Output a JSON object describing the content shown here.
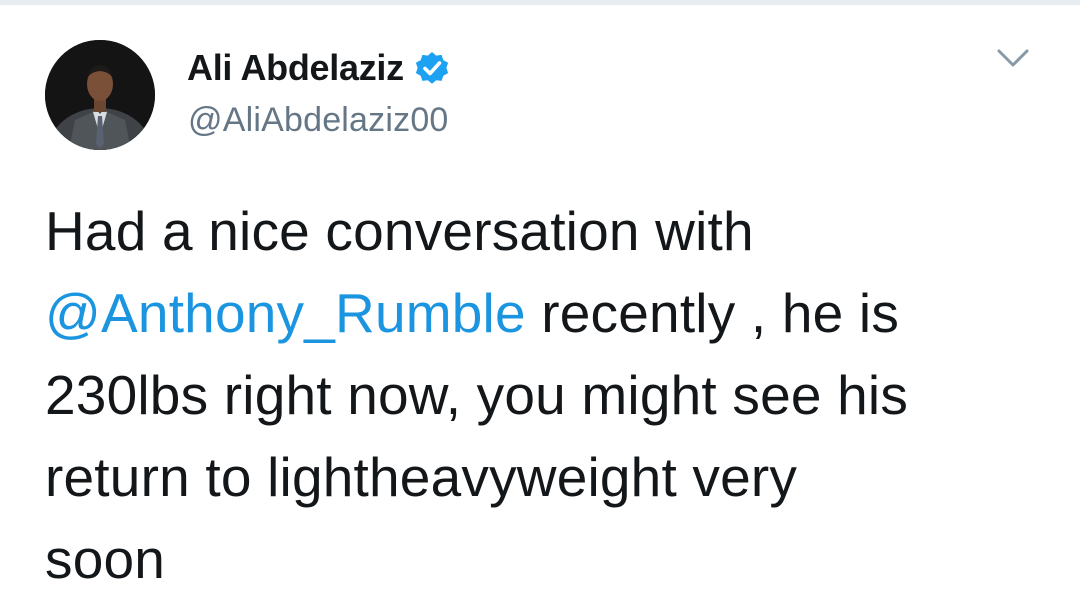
{
  "tweet": {
    "author": {
      "display_name": "Ali Abdelaziz",
      "handle": "@AliAbdelaziz00",
      "verified": true,
      "avatar_icon": "profile-photo-man-in-suit"
    },
    "text_lines": [
      {
        "pre": "Had a nice conversation with"
      },
      {
        "mention": "@Anthony_Rumble",
        "post": " recently , he is"
      },
      {
        "pre": "230lbs right now, you might see his"
      },
      {
        "pre": "return to lightheavyweight very"
      },
      {
        "pre": "soon"
      }
    ]
  },
  "icons": {
    "verified": "verified-badge-icon",
    "menu": "chevron-down-icon"
  },
  "colors": {
    "text": "#14171a",
    "secondary": "#657786",
    "link": "#1b95e0",
    "verified": "#1da1f2",
    "divider": "#e6ecf0"
  }
}
